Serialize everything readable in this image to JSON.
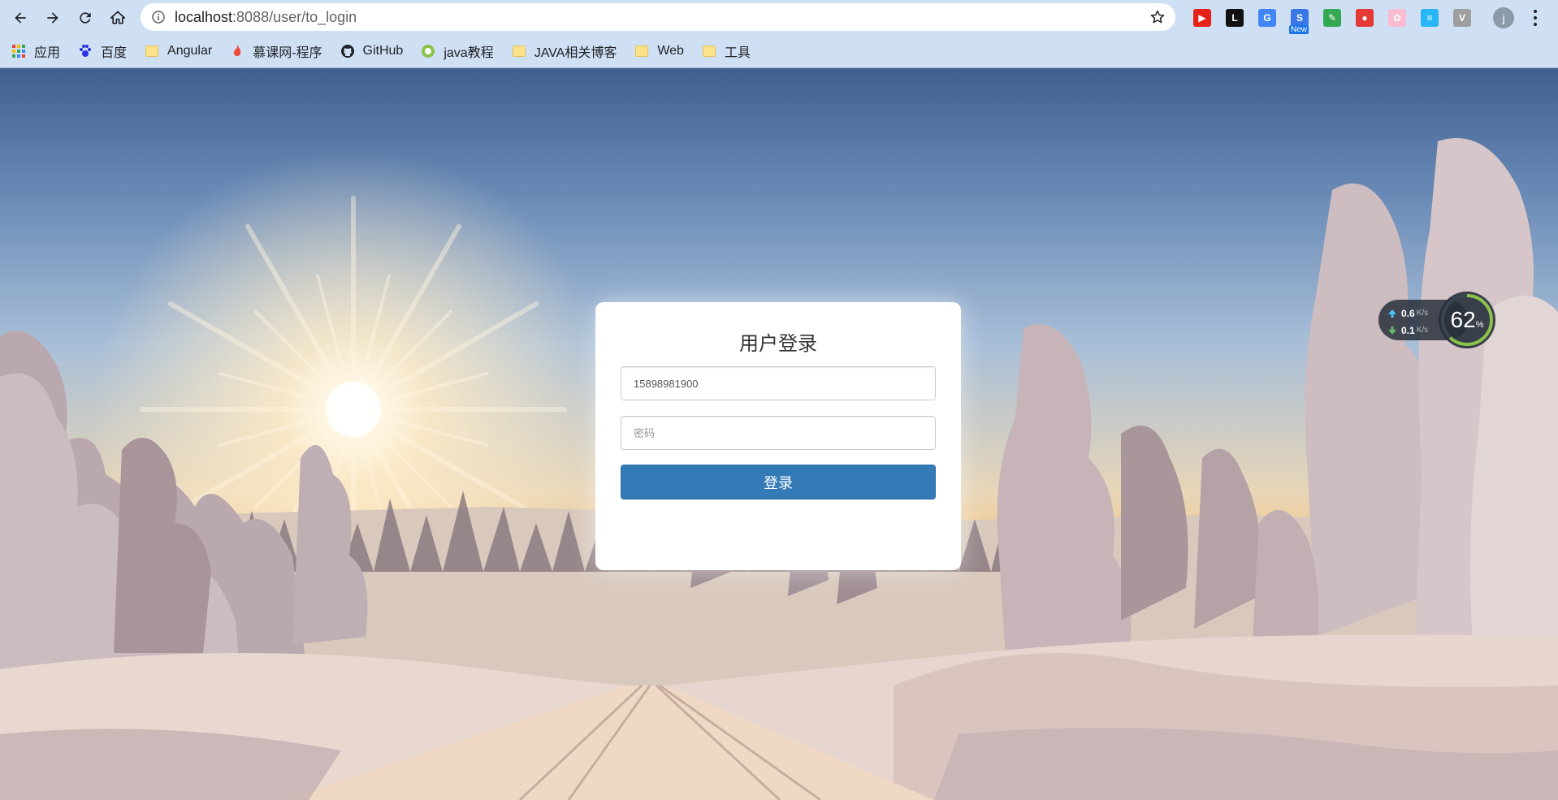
{
  "browser": {
    "url_host": "localhost",
    "url_rest": ":8088/user/to_login",
    "extensions": [
      {
        "name": "youtube-extension-icon",
        "color": "#e62117",
        "glyph": "▶"
      },
      {
        "name": "l-extension-icon",
        "color": "#111111",
        "glyph": "L"
      },
      {
        "name": "translate-extension-icon",
        "color": "#4285f4",
        "glyph": "G"
      },
      {
        "name": "new-extension-icon",
        "color": "#3b78e7",
        "glyph": "S",
        "badge": "New"
      },
      {
        "name": "colorful-extension-icon",
        "color": "#34a853",
        "glyph": "✎"
      },
      {
        "name": "red-extension-icon",
        "color": "#e53935",
        "glyph": "●"
      },
      {
        "name": "pink-extension-icon",
        "color": "#f8bbd0",
        "glyph": "✿"
      },
      {
        "name": "blue-doc-extension-icon",
        "color": "#29b6f6",
        "glyph": "≡"
      },
      {
        "name": "v-extension-icon",
        "color": "#9e9e9e",
        "glyph": "V"
      }
    ],
    "avatar_letter": "j"
  },
  "bookmarks": [
    {
      "label": "应用",
      "icon": "apps-grid-icon"
    },
    {
      "label": "百度",
      "icon": "baidu-paw-icon"
    },
    {
      "label": "Angular",
      "icon": "folder-icon"
    },
    {
      "label": "慕课网-程序",
      "icon": "flame-icon"
    },
    {
      "label": "GitHub",
      "icon": "github-icon"
    },
    {
      "label": "java教程",
      "icon": "green-circle-icon"
    },
    {
      "label": "JAVA相关博客",
      "icon": "folder-icon"
    },
    {
      "label": "Web",
      "icon": "folder-icon"
    },
    {
      "label": "工具",
      "icon": "folder-icon"
    }
  ],
  "login": {
    "title": "用户登录",
    "username_value": "15898981900",
    "password_placeholder": "密码",
    "submit_label": "登录"
  },
  "speed_widget": {
    "upload": "0.6",
    "download": "0.1",
    "unit": "K/s",
    "percent": "62",
    "percent_sign": "%",
    "percent_value": 62
  }
}
